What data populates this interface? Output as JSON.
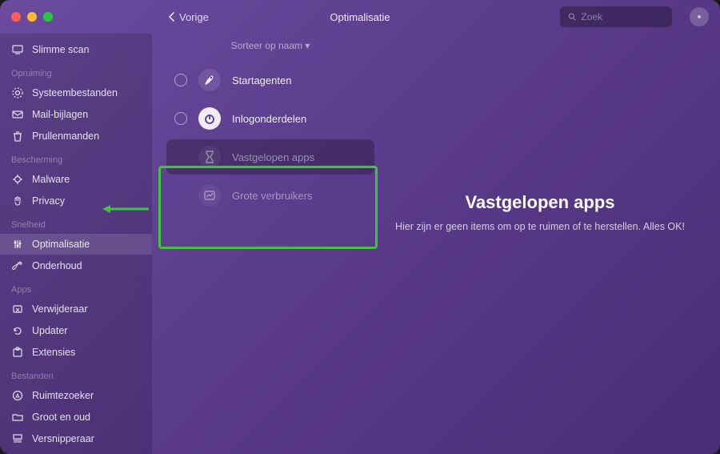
{
  "header": {
    "back_label": "Vorige",
    "title": "Optimalisatie",
    "search_placeholder": "Zoek"
  },
  "sidebar": {
    "smart_scan": "Slimme scan",
    "sections": {
      "cleanup": {
        "heading": "Opruiming",
        "items": [
          "Systeembestanden",
          "Mail-bijlagen",
          "Prullenmanden"
        ]
      },
      "protection": {
        "heading": "Bescherming",
        "items": [
          "Malware",
          "Privacy"
        ]
      },
      "speed": {
        "heading": "Snelheid",
        "items": [
          "Optimalisatie",
          "Onderhoud"
        ]
      },
      "apps": {
        "heading": "Apps",
        "items": [
          "Verwijderaar",
          "Updater",
          "Extensies"
        ]
      },
      "files": {
        "heading": "Bestanden",
        "items": [
          "Ruimtezoeker",
          "Groot en oud",
          "Versnipperaar"
        ]
      }
    }
  },
  "list": {
    "sort_label": "Sorteer op naam ▾",
    "categories": [
      {
        "label": "Startagenten",
        "icon": "rocket",
        "selectable": true,
        "dim": false
      },
      {
        "label": "Inlogonderdelen",
        "icon": "power",
        "selectable": true,
        "dim": false
      },
      {
        "label": "Vastgelopen apps",
        "icon": "hourglass",
        "selectable": false,
        "dim": true,
        "selected": true
      },
      {
        "label": "Grote verbruikers",
        "icon": "chart",
        "selectable": false,
        "dim": true
      }
    ]
  },
  "detail": {
    "title": "Vastgelopen apps",
    "subtitle": "Hier zijn er geen items om op te ruimen of te herstellen. Alles OK!"
  }
}
